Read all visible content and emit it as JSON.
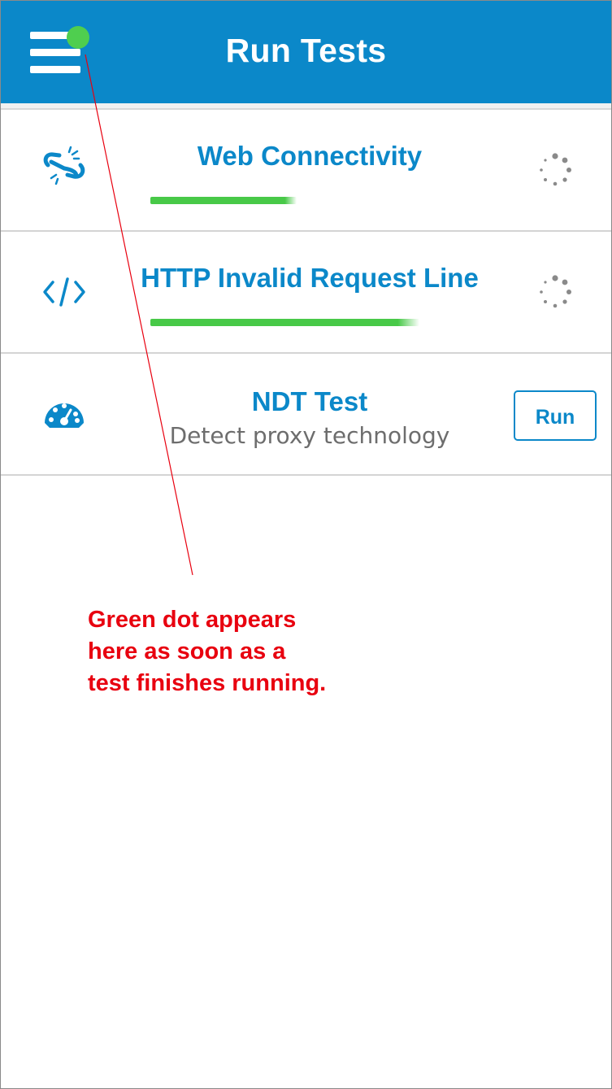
{
  "header": {
    "title": "Run Tests",
    "menu_icon": "hamburger-menu-icon",
    "notification_dot_color": "#4fce4f",
    "background_color": "#0b88c9"
  },
  "tests": [
    {
      "name": "Web Connectivity",
      "icon": "broken-link-icon",
      "status": "running",
      "progress": 0.5
    },
    {
      "name": "HTTP Invalid Request Line",
      "icon": "code-icon",
      "status": "running",
      "progress": 0.92
    },
    {
      "name": "NDT Test",
      "description": "Detect proxy technology",
      "icon": "speedometer-icon",
      "status": "idle",
      "run_label": "Run"
    }
  ],
  "annotation": {
    "lines": [
      "Green dot appears",
      "here as soon as a",
      "test finishes running."
    ],
    "color": "#e8000f"
  },
  "colors": {
    "accent": "#0b88c9",
    "progress": "#48c948"
  }
}
